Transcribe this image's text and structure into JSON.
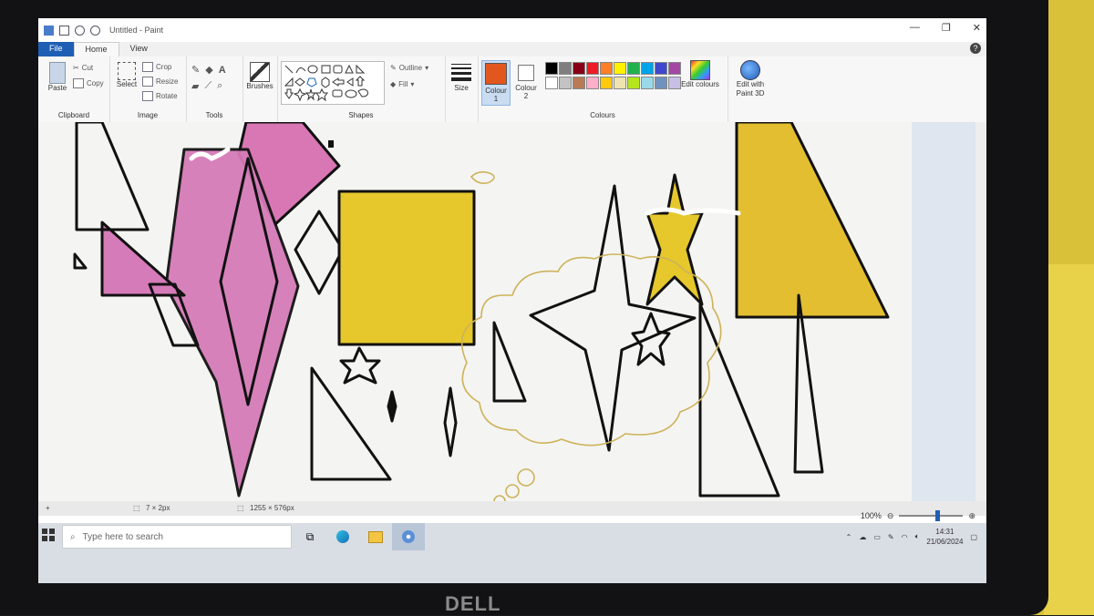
{
  "window": {
    "title": "Untitled - Paint"
  },
  "tabs": [
    {
      "label": "File"
    },
    {
      "label": "Home"
    },
    {
      "label": "View"
    }
  ],
  "ribbon": {
    "clipboard": {
      "paste": "Paste",
      "cut": "Cut",
      "copy": "Copy",
      "label": "Clipboard"
    },
    "image": {
      "select": "Select",
      "crop": "Crop",
      "resize": "Resize",
      "rotate": "Rotate",
      "label": "Image"
    },
    "tools": {
      "label": "Tools"
    },
    "brushes": {
      "label": "Brushes"
    },
    "shapes": {
      "outline": "Outline",
      "fill": "Fill",
      "label": "Shapes"
    },
    "size": {
      "label": "Size"
    },
    "colours": {
      "colour1": "Colour",
      "colour1_num": "1",
      "colour2": "Colour",
      "colour2_num": "2",
      "edit": "Edit colours",
      "label": "Colours",
      "paint3d": "Edit with Paint 3D",
      "colour1_value": "#e2571e",
      "colour2_value": "#ffffff",
      "palette_row1": [
        "#000000",
        "#7f7f7f",
        "#880015",
        "#ed1c24",
        "#ff7f27",
        "#fff200",
        "#22b14c",
        "#00a2e8",
        "#3f48cc",
        "#a349a4"
      ],
      "palette_row2": [
        "#ffffff",
        "#c3c3c3",
        "#b97a57",
        "#ffaec9",
        "#ffc90e",
        "#efe4b0",
        "#b5e61d",
        "#99d9ea",
        "#7092be",
        "#c8bfe7"
      ]
    }
  },
  "status": {
    "selection_size": "7 × 2px",
    "image_size": "1255 × 576px"
  },
  "zoom": {
    "level": "100%"
  },
  "taskbar": {
    "search_placeholder": "Type here to search",
    "time": "14:31",
    "date": "21/06/2024"
  },
  "brand": "DELL"
}
